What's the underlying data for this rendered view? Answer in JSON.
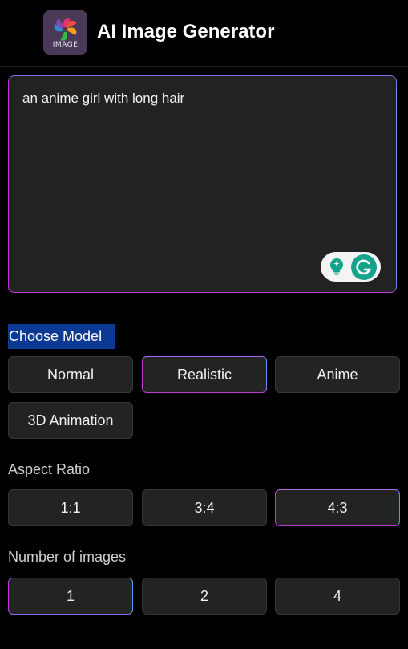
{
  "header": {
    "app_title": "AI Image Generator",
    "logo_text": "IMAGE"
  },
  "prompt": {
    "value": "an anime girl with long hair"
  },
  "grammarly": {
    "bulb_icon": "lightbulb-icon",
    "g_icon": "grammarly-icon"
  },
  "model": {
    "label": "Choose Model",
    "options": [
      "Normal",
      "Realistic",
      "Anime",
      "3D Animation"
    ],
    "selected": "Realistic"
  },
  "aspect_ratio": {
    "label": "Aspect Ratio",
    "options": [
      "1:1",
      "3:4",
      "4:3"
    ],
    "selected": "4:3"
  },
  "num_images": {
    "label": "Number of images",
    "options": [
      "1",
      "2",
      "4"
    ],
    "selected": "1"
  },
  "colors": {
    "background": "#000000",
    "card": "#222222",
    "accent_pink": "#c13ad8",
    "accent_blue": "#6f8af0",
    "highlight": "#0b3a94",
    "grammarly_green": "#14a38b"
  }
}
